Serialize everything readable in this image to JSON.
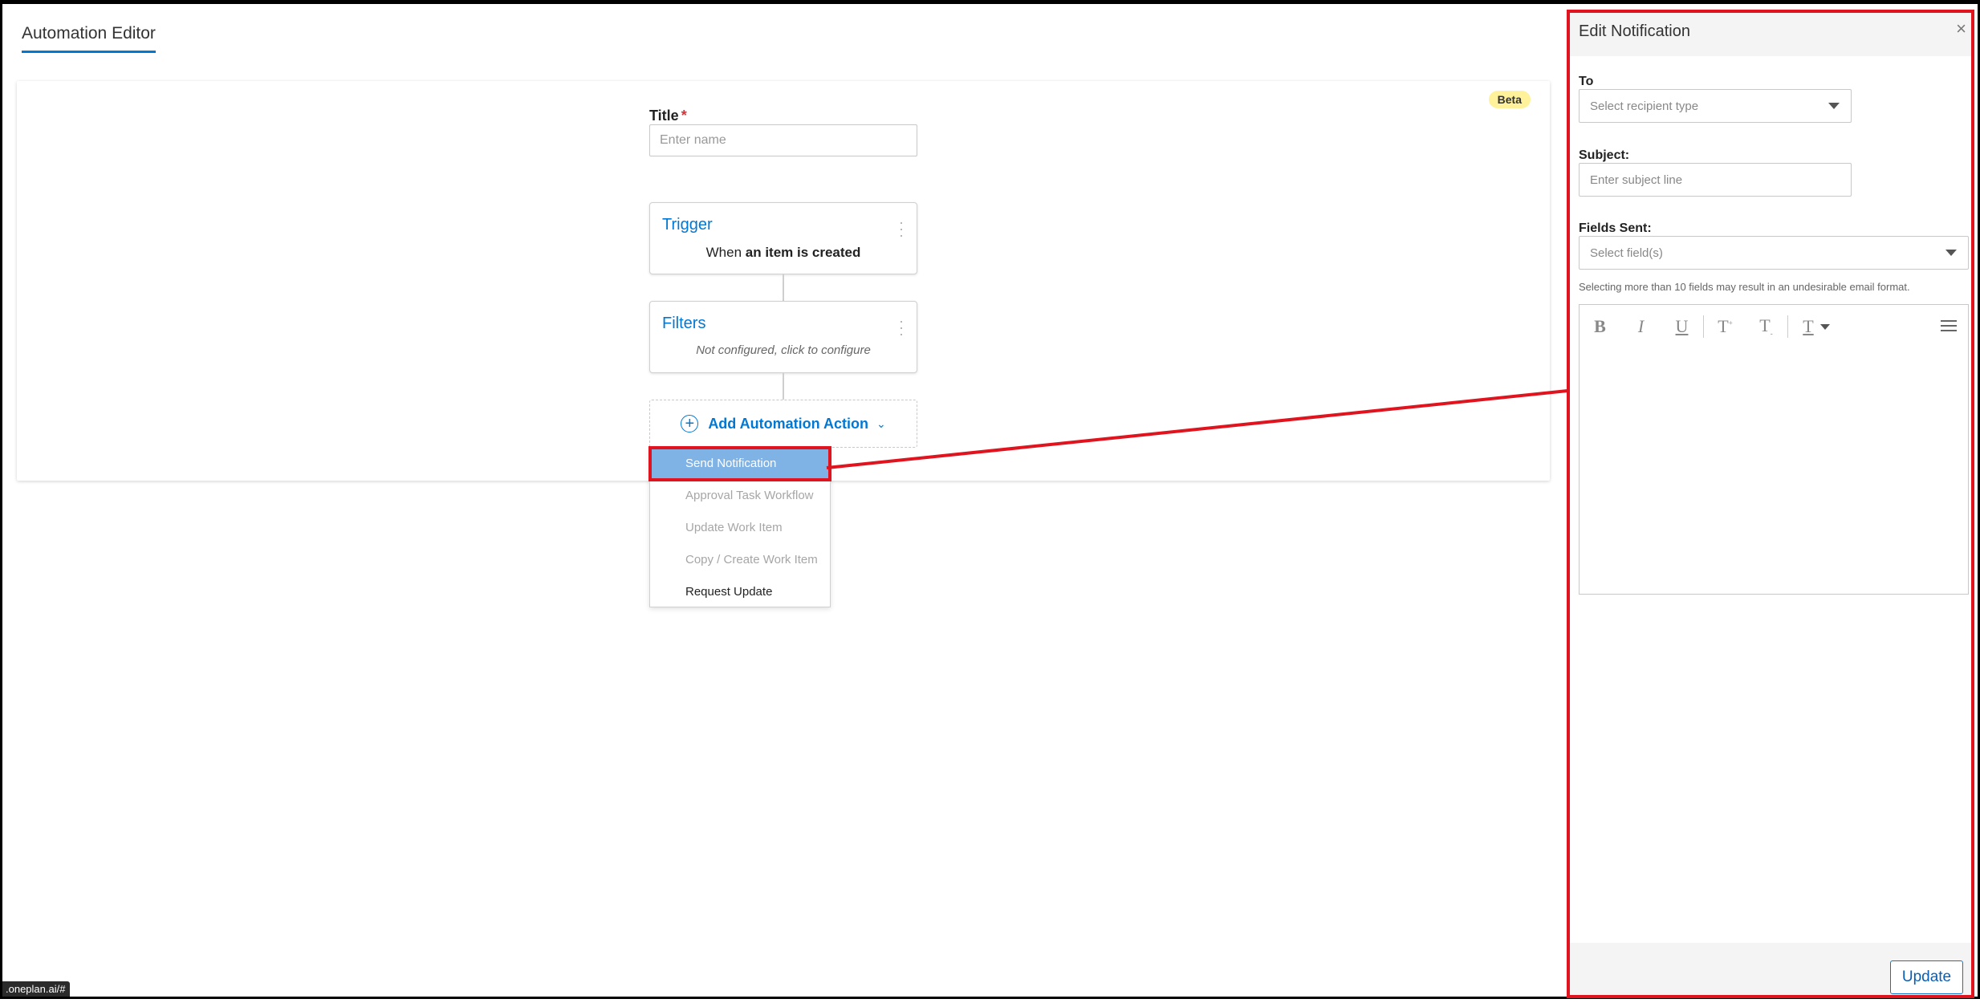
{
  "header": {
    "tab_title": "Automation Editor"
  },
  "canvas": {
    "beta_badge": "Beta",
    "title_label": "Title",
    "title_required": "*",
    "title_placeholder": "Enter name",
    "trigger": {
      "title": "Trigger",
      "desc_prefix": "When",
      "desc_bold": "an item is created"
    },
    "filters": {
      "title": "Filters",
      "desc": "Not configured, click to configure"
    },
    "add_action": {
      "label": "Add Automation Action"
    },
    "menu": [
      {
        "label": "Send Notification",
        "state": "selected"
      },
      {
        "label": "Approval Task Workflow",
        "state": "disabled"
      },
      {
        "label": "Update Work Item",
        "state": "disabled"
      },
      {
        "label": "Copy / Create Work Item",
        "state": "disabled"
      },
      {
        "label": "Request Update",
        "state": "enabled"
      }
    ]
  },
  "panel": {
    "title": "Edit Notification",
    "to_label": "To",
    "to_placeholder": "Select recipient type",
    "subject_label": "Subject:",
    "subject_placeholder": "Enter subject line",
    "fields_label": "Fields Sent:",
    "fields_placeholder": "Select field(s)",
    "fields_hint": "Selecting more than 10 fields may result in an undesirable email format.",
    "toolbar": {
      "bold": "B",
      "italic": "I",
      "underline": "U",
      "superscript": "T",
      "subscript": "T",
      "font_color": "T"
    },
    "update_label": "Update"
  },
  "status_bar": {
    "url": ".oneplan.ai/#"
  },
  "colors": {
    "accent": "#0078d4",
    "highlight": "#e0141e",
    "selected_item": "#7fb2e5",
    "beta": "#fff29a"
  }
}
